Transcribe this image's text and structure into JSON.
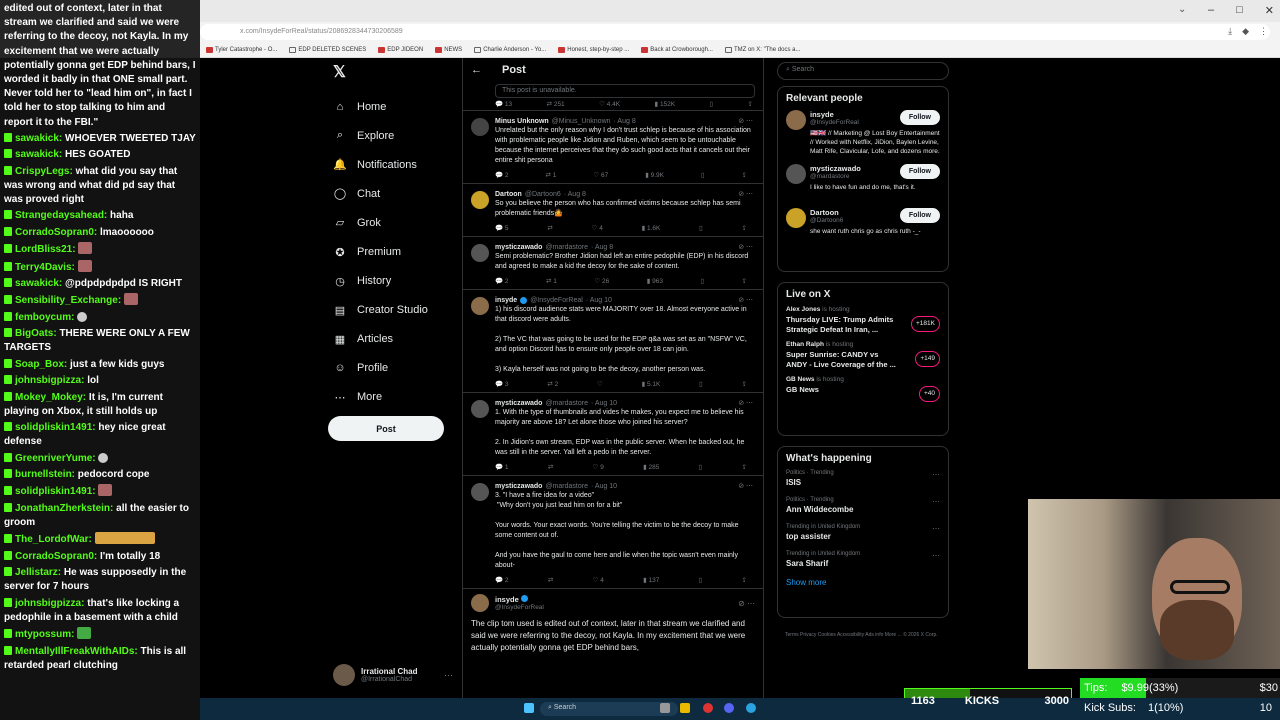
{
  "browser": {
    "url": "x.com/InsydeForReal/status/2086928344730206589",
    "bookmarks": [
      "Tyler Catastrophe - O...",
      "EDP DELETED SCENES",
      "EDP JIDEON",
      "NEWS",
      "Charlie Anderson - Yo...",
      "Honest, step-by-step ...",
      "Back at Crowborough...",
      "TMZ on X: \"The docs a..."
    ]
  },
  "chat": {
    "first": "edited out of context, later in that stream we clarified and said we were referring to the decoy, not Kayla. In my excitement that we were actually potentially gonna get EDP behind bars, I worded it badly in that ONE small part. Never told her to \"lead him on\", in fact I told her to stop talking to him and report it to the FBI.\"",
    "messages": [
      {
        "user": "sawakick:",
        "text": "WHOEVER TWEETED TJAY",
        "emote": ""
      },
      {
        "user": "sawakick:",
        "text": "HES GOATED",
        "emote": ""
      },
      {
        "user": "CrispyLegs:",
        "text": "what did you say that was wrong and what did pd say that was proved right",
        "emote": ""
      },
      {
        "user": "Strangedaysahead:",
        "text": "haha",
        "emote": ""
      },
      {
        "user": "CorradoSopran0:",
        "text": "lmaoooooo",
        "emote": ""
      },
      {
        "user": "LordBliss21:",
        "text": "",
        "emote": "e1"
      },
      {
        "user": "Terry4Davis:",
        "text": "",
        "emote": "e1"
      },
      {
        "user": "sawakick:",
        "text": "@pdpdpdpdpd IS RIGHT",
        "emote": ""
      },
      {
        "user": "Sensibility_Exchange:",
        "text": "",
        "emote": "e1"
      },
      {
        "user": "femboycum:",
        "text": "",
        "emote": "e2"
      },
      {
        "user": "BigOats:",
        "text": "THERE WERE ONLY A FEW TARGETS",
        "emote": ""
      },
      {
        "user": "Soap_Box:",
        "text": "just a few kids guys",
        "emote": ""
      },
      {
        "user": "johnsbigpizza:",
        "text": "lol",
        "emote": ""
      },
      {
        "user": "Mokey_Mokey:",
        "text": "It is, I'm current playing on Xbox, it still holds up",
        "emote": ""
      },
      {
        "user": "solidpliskin1491:",
        "text": "hey nice great defense",
        "emote": ""
      },
      {
        "user": "GreenriverYume:",
        "text": "",
        "emote": "e2"
      },
      {
        "user": "burnellstein:",
        "text": "pedocord cope",
        "emote": ""
      },
      {
        "user": "solidpliskin1491:",
        "text": "",
        "emote": "e1"
      },
      {
        "user": "JonathanZherkstein:",
        "text": "all the easier to groom",
        "emote": ""
      },
      {
        "user": "The_LordofWar:",
        "text": "",
        "emote": "e3"
      },
      {
        "user": "CorradoSopran0:",
        "text": "I'm totally 18",
        "emote": ""
      },
      {
        "user": "Jellistarz:",
        "text": "He was supposedly in the server for 7 hours",
        "emote": ""
      },
      {
        "user": "johnsbigpizza:",
        "text": "that's like locking a pedophile in a basement with a child",
        "emote": ""
      },
      {
        "user": "mtypossum:",
        "text": "",
        "emote": "e4"
      },
      {
        "user": "MentallyIllFreakWithAIDs:",
        "text": "This is all retarded pearl clutching",
        "emote": ""
      }
    ]
  },
  "nav": {
    "items": [
      {
        "icon": "home-icon",
        "glyph": "⌂",
        "label": "Home"
      },
      {
        "icon": "explore-icon",
        "glyph": "⌕",
        "label": "Explore"
      },
      {
        "icon": "notifications-icon",
        "glyph": "🔔",
        "label": "Notifications"
      },
      {
        "icon": "chat-icon",
        "glyph": "◯",
        "label": "Chat"
      },
      {
        "icon": "grok-icon",
        "glyph": "▱",
        "label": "Grok"
      },
      {
        "icon": "premium-icon",
        "glyph": "✪",
        "label": "Premium"
      },
      {
        "icon": "history-icon",
        "glyph": "◷",
        "label": "History"
      },
      {
        "icon": "creator-studio-icon",
        "glyph": "▤",
        "label": "Creator Studio"
      },
      {
        "icon": "articles-icon",
        "glyph": "▦",
        "label": "Articles"
      },
      {
        "icon": "profile-icon",
        "glyph": "☺",
        "label": "Profile"
      },
      {
        "icon": "more-icon",
        "glyph": "⋯",
        "label": "More"
      }
    ],
    "post_label": "Post",
    "account_name": "Irrational Chad",
    "account_handle": "@IrrationalChad"
  },
  "main": {
    "title": "Post",
    "unavailable": "This post is unavailable.",
    "top_actions": [
      "13",
      "251",
      "4.4K",
      "152K"
    ],
    "tweets": [
      {
        "name": "Minus Unknown",
        "handle": "@Minus_Unknown",
        "date": "· Aug 8",
        "body": "Unrelated but the only reason why I don't trust schlep is because of his association with problematic people like Jidion and Ruben, which seem to be untouchable because the internet perceives that they do such good acts that it cancels out their entire shit persona",
        "replies": "2",
        "reposts": "1",
        "likes": "67",
        "views": "9.9K"
      },
      {
        "name": "Dartoon",
        "handle": "@Dartoon6",
        "date": "· Aug 8",
        "body": "So you believe the person who has confirmed victims because schlep has semi problematic friends🤷",
        "replies": "5",
        "reposts": "",
        "likes": "4",
        "views": "1.6K"
      },
      {
        "name": "mysticzawado",
        "handle": "@mardastore",
        "date": "· Aug 8",
        "body": "Semi problematic? Brother Jidion had left an entire pedophile (EDP) in his discord and agreed to make a kid the decoy for the sake of content.",
        "replies": "2",
        "reposts": "1",
        "likes": "26",
        "views": "963"
      },
      {
        "name": "insyde",
        "handle": "@InsydeForReal",
        "date": "· Aug 10",
        "body": "1) his discord audience stats were MAJORITY over 18. Almost everyone active in that discord were adults.\n\n2) The VC that was going to be used for the EDP q&a was set as an \"NSFW\" VC, and option Discord has to ensure only people over 18 can join.\n\n3) Kayla herself was not going to be the decoy, another person was.",
        "replies": "3",
        "reposts": "2",
        "likes": "",
        "views": "5.1K"
      },
      {
        "name": "mysticzawado",
        "handle": "@mardastore",
        "date": "· Aug 10",
        "body": "1. With the type of thumbnails and vides he makes, you expect me to believe his majority are above 18? Let alone those who joined his server?\n\n2. In Jidion's own stream, EDP was in the public server. When he backed out, he was still in the server. Yall left a pedo in the server.",
        "replies": "1",
        "reposts": "",
        "likes": "9",
        "views": "285"
      },
      {
        "name": "mysticzawado",
        "handle": "@mardastore",
        "date": "· Aug 10",
        "body": "3. \"I have a fire idea for a video\"\n \"Why don't you just lead him on for a bit\"\n\nYour words. Your exact words. You're telling the victim to be the decoy to make some content out of.\n\nAnd you have the gaul to come here and lie when the topic wasn't even mainly about-",
        "replies": "2",
        "reposts": "",
        "likes": "4",
        "views": "137"
      }
    ],
    "last": {
      "name": "insyde",
      "handle": "@InsydeForReal",
      "body": "The clip tom used is edited out of context, later in that stream we clarified and said we were referring to the decoy, not Kayla. In my excitement that we were actually potentially gonna get EDP behind bars,"
    }
  },
  "right": {
    "search_placeholder": "Search",
    "relevant_title": "Relevant people",
    "people": [
      {
        "name": "insyde",
        "handle": "@InsydeForReal",
        "bio": "🇺🇸🇬🇧 // Marketing @ Lost Boy Entertainment // Worked with Netflix, JiDion, Baylen Levine, Matt Rife, Clavicular, Lofe, and dozens more.",
        "follow": "Follow"
      },
      {
        "name": "mysticzawado",
        "handle": "@mardastore",
        "bio": "I like to have fun and do me, that's it.",
        "follow": "Follow"
      },
      {
        "name": "Dartoon",
        "handle": "@Dartoon6",
        "bio": "she want ruth chris go as chris ruth -_-",
        "follow": "Follow"
      }
    ],
    "live_title": "Live on X",
    "live": [
      {
        "host": "Alex Jones",
        "status": "is hosting",
        "title": "Thursday LIVE: Trump Admits Strategic Defeat In Iran, ...",
        "count": "+181K"
      },
      {
        "host": "Ethan Ralph",
        "status": "is hosting",
        "title": "Super Sunrise: CANDY vs ANDY - Live Coverage of the ...",
        "count": "+149"
      },
      {
        "host": "GB News",
        "status": "is hosting",
        "title": "GB News",
        "count": "+40"
      }
    ],
    "happening_title": "What's happening",
    "trends": [
      {
        "cat": "Politics · Trending",
        "title": "ISIS"
      },
      {
        "cat": "Politics · Trending",
        "title": "Ann Widdecombe"
      },
      {
        "cat": "Trending in United Kingdom",
        "title": "top assister"
      },
      {
        "cat": "Trending in United Kingdom",
        "title": "Sara Sharif"
      }
    ],
    "show_more": "Show more",
    "footer": "Terms   Privacy   Cookies   Accessibility   Ads info   More ...   © 2026 X Corp."
  },
  "overlay": {
    "kicks_current": "1163",
    "kicks_label": "KICKS",
    "kicks_goal": "3000",
    "kicks_fraction": 0.39,
    "tips_label": "Tips:",
    "tips_value": "$9.99(33%)",
    "tips_goal": "$30",
    "tips_fraction": 0.33,
    "subs_label": "Kick Subs:",
    "subs_value": "1(10%)",
    "subs_goal": "10",
    "subs_fraction": 0.1
  },
  "taskbar": {
    "search": "Search"
  }
}
